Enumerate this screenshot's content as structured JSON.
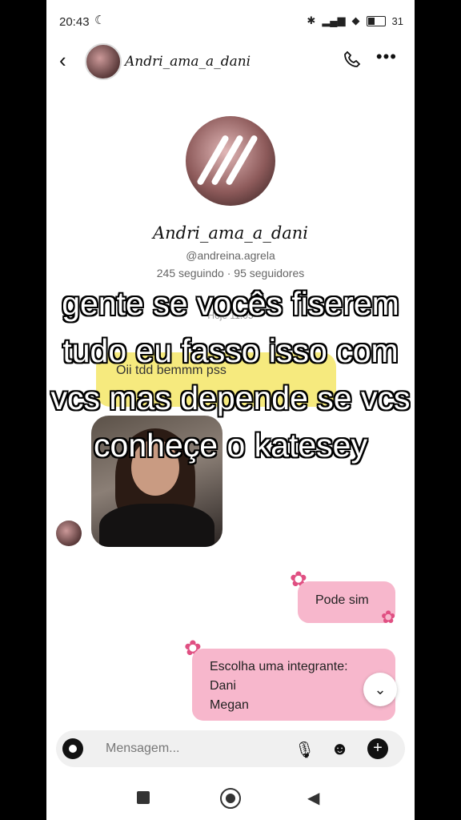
{
  "status_bar": {
    "time": "20:43",
    "battery": "31"
  },
  "header": {
    "contact_name": "Andri_ama_a_dani",
    "icons": [
      "back-icon",
      "phone-icon",
      "more-icon"
    ]
  },
  "profile": {
    "name": "Andri_ama_a_dani",
    "handle": "@andreina.agrela",
    "stats": "245 seguindo · 95 seguidores"
  },
  "timestamp": "Hoje 11:05",
  "messages": {
    "received_text": "Oii tdd bemmm pss",
    "sent_1": "Pode sim",
    "sent_2_lines": [
      "Escolha uma integrante:",
      "Dani",
      "Megan"
    ]
  },
  "composer": {
    "placeholder": "Mensagem..."
  },
  "overlay_caption": {
    "lines": [
      "gente se vocês fiserem",
      "tudo eu fasso isso com",
      "vcs mas depende se vcs",
      "conheçe o katesey"
    ]
  },
  "colors": {
    "received_bubble": "#f6ea7e",
    "sent_bubble": "#f7b7cc",
    "flower": "#e04f82"
  }
}
